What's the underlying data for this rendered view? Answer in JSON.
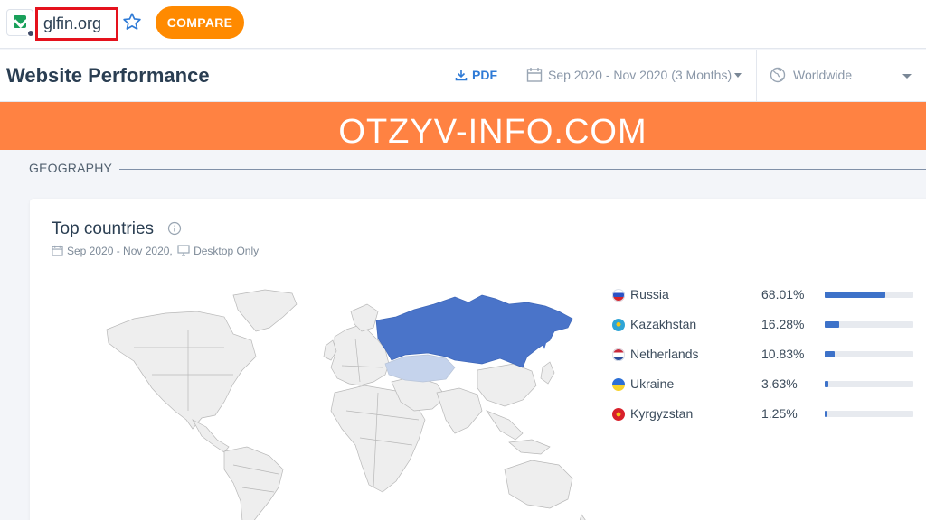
{
  "topbar": {
    "domain": "glfin.org",
    "compare_label": "COMPARE"
  },
  "header": {
    "title": "Website Performance",
    "pdf_label": "PDF",
    "date_range": "Sep 2020 - Nov 2020 (3 Months)",
    "region": "Worldwide"
  },
  "banner": {
    "text": "OTZYV-INFO.COM",
    "color": "#ff8242"
  },
  "section": {
    "label": "GEOGRAPHY"
  },
  "top_countries": {
    "title": "Top countries",
    "date": "Sep 2020 - Nov 2020,",
    "device": "Desktop Only",
    "countries": [
      {
        "name": "Russia",
        "share": "68.01%",
        "value": 0.6801,
        "flag": "russia-flag-icon"
      },
      {
        "name": "Kazakhstan",
        "share": "16.28%",
        "value": 0.1628,
        "flag": "kazakhstan-flag-icon"
      },
      {
        "name": "Netherlands",
        "share": "10.83%",
        "value": 0.1083,
        "flag": "netherlands-flag-icon"
      },
      {
        "name": "Ukraine",
        "share": "3.63%",
        "value": 0.0363,
        "flag": "ukraine-flag-icon"
      },
      {
        "name": "Kyrgyzstan",
        "share": "1.25%",
        "value": 0.0125,
        "flag": "kyrgyzstan-flag-icon"
      }
    ]
  },
  "colors": {
    "accent": "#ff8a00",
    "bar": "#3d72c9",
    "map_highlight": "#4a74c9",
    "map_secondary": "#c5d3ec",
    "domain_highlight_border": "#e5121d"
  }
}
